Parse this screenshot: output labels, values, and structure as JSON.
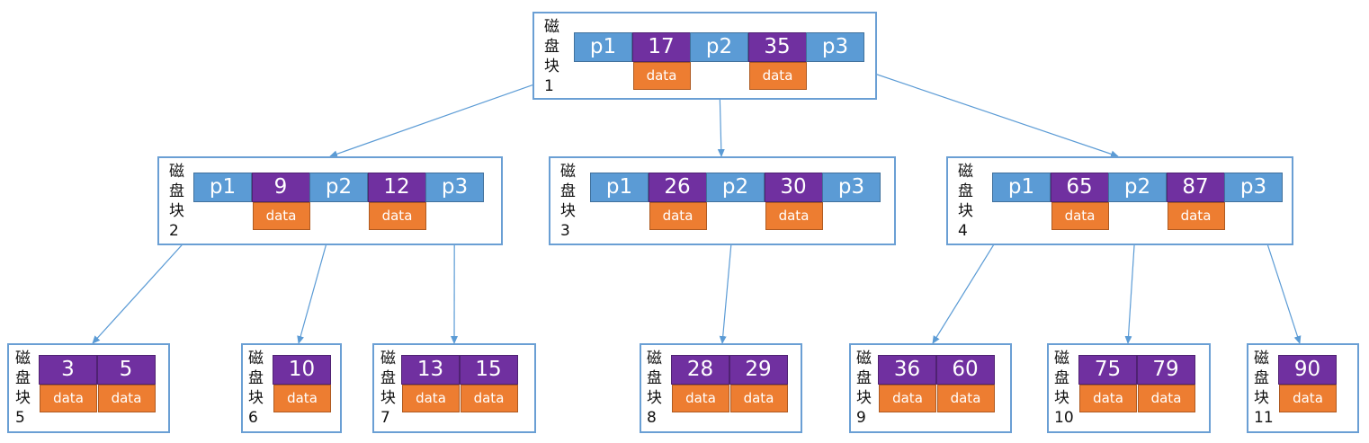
{
  "block_label": "磁\n盘\n块",
  "data_label": "data",
  "colors": {
    "pointer": "#5b9bd5",
    "key": "#7030a0",
    "data": "#ed7d31",
    "border": "#6a9fd4",
    "edge": "#5b9bd5"
  },
  "blocks": [
    {
      "id": "1",
      "cells": [
        {
          "t": "p",
          "text": "p1"
        },
        {
          "t": "k",
          "text": "17"
        },
        {
          "t": "p",
          "text": "p2"
        },
        {
          "t": "k",
          "text": "35"
        },
        {
          "t": "p",
          "text": "p3"
        }
      ]
    },
    {
      "id": "2",
      "cells": [
        {
          "t": "p",
          "text": "p1"
        },
        {
          "t": "k",
          "text": "9"
        },
        {
          "t": "p",
          "text": "p2"
        },
        {
          "t": "k",
          "text": "12"
        },
        {
          "t": "p",
          "text": "p3"
        }
      ]
    },
    {
      "id": "3",
      "cells": [
        {
          "t": "p",
          "text": "p1"
        },
        {
          "t": "k",
          "text": "26"
        },
        {
          "t": "p",
          "text": "p2"
        },
        {
          "t": "k",
          "text": "30"
        },
        {
          "t": "p",
          "text": "p3"
        }
      ]
    },
    {
      "id": "4",
      "cells": [
        {
          "t": "p",
          "text": "p1"
        },
        {
          "t": "k",
          "text": "65"
        },
        {
          "t": "p",
          "text": "p2"
        },
        {
          "t": "k",
          "text": "87"
        },
        {
          "t": "p",
          "text": "p3"
        }
      ]
    },
    {
      "id": "5",
      "cells": [
        {
          "t": "k",
          "text": "3"
        },
        {
          "t": "k",
          "text": "5"
        }
      ]
    },
    {
      "id": "6",
      "cells": [
        {
          "t": "k",
          "text": "10"
        }
      ]
    },
    {
      "id": "7",
      "cells": [
        {
          "t": "k",
          "text": "13"
        },
        {
          "t": "k",
          "text": "15"
        }
      ]
    },
    {
      "id": "8",
      "cells": [
        {
          "t": "k",
          "text": "28"
        },
        {
          "t": "k",
          "text": "29"
        }
      ]
    },
    {
      "id": "9",
      "cells": [
        {
          "t": "k",
          "text": "36"
        },
        {
          "t": "k",
          "text": "60"
        }
      ]
    },
    {
      "id": "10",
      "cells": [
        {
          "t": "k",
          "text": "75"
        },
        {
          "t": "k",
          "text": "79"
        }
      ]
    },
    {
      "id": "11",
      "cells": [
        {
          "t": "k",
          "text": "90"
        }
      ]
    }
  ],
  "edges": [
    {
      "from": "1",
      "ptr": "p1",
      "to": "2"
    },
    {
      "from": "1",
      "ptr": "p2",
      "to": "3"
    },
    {
      "from": "1",
      "ptr": "p3",
      "to": "4"
    },
    {
      "from": "2",
      "ptr": "p1",
      "to": "5"
    },
    {
      "from": "2",
      "ptr": "p2",
      "to": "6"
    },
    {
      "from": "2",
      "ptr": "p3",
      "to": "7"
    },
    {
      "from": "3",
      "ptr": "p2",
      "to": "8"
    },
    {
      "from": "4",
      "ptr": "p1",
      "to": "9"
    },
    {
      "from": "4",
      "ptr": "p2",
      "to": "10"
    },
    {
      "from": "4",
      "ptr": "p3",
      "to": "11"
    }
  ]
}
